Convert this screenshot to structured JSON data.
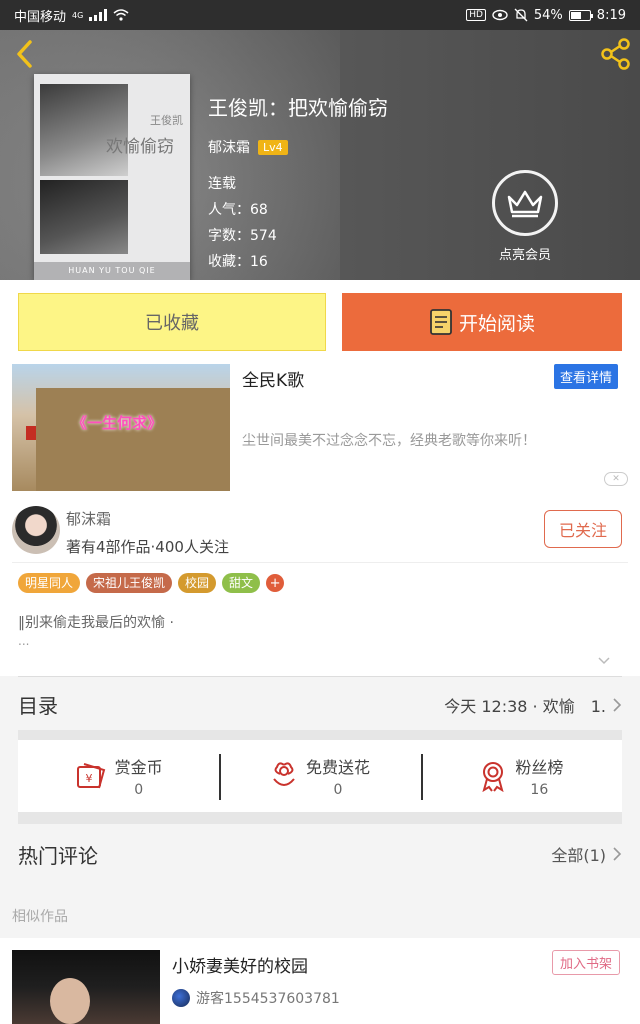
{
  "status_bar": {
    "carrier": "中国移动",
    "network": "4G",
    "battery": "54%",
    "battery_level": 0.54,
    "time": "8:19",
    "hd_label": "HD"
  },
  "book": {
    "title": "王俊凯：把欢愉偷窃",
    "author": "郁沫霜",
    "level": "Lv4",
    "status": "连载",
    "popularity": "人气：68",
    "word_count": "字数：574",
    "favorites": "收藏：16",
    "cover_title": "欢愉偷窃",
    "cover_name": "王俊凯",
    "cover_pinyin": "HUAN YU TOU QIE"
  },
  "vip": {
    "label": "点亮会员"
  },
  "actions": {
    "favorited_label": "已收藏",
    "read_label": "开始阅读"
  },
  "ad": {
    "image_text": "《一生何求》",
    "title": "全民K歌",
    "button": "查看详情",
    "description": "尘世间最美不过念念不忘，经典老歌等你来听！"
  },
  "author_card": {
    "name": "郁沫霜",
    "stats": "著有4部作品·400人关注",
    "follow_label": "已关注",
    "tags": [
      {
        "label": "明星同人",
        "color": "#f0a63a"
      },
      {
        "label": "宋祖儿王俊凯",
        "color": "#c56a4a"
      },
      {
        "label": "校园",
        "color": "#d49a2e"
      },
      {
        "label": "甜文",
        "color": "#8fbf4a"
      }
    ],
    "tag_add": "+",
    "intro": "‖别来偷走我最后的欢愉 ·",
    "intro_more": "..."
  },
  "toc": {
    "title": "目录",
    "latest": "今天 12:38 · 欢愉　1."
  },
  "stats": [
    {
      "label": "赏金币",
      "value": "0",
      "icon": "red-envelope-icon"
    },
    {
      "label": "免费送花",
      "value": "0",
      "icon": "flower-icon"
    },
    {
      "label": "粉丝榜",
      "value": "16",
      "icon": "medal-icon"
    }
  ],
  "comments": {
    "title": "热门评论",
    "all_label": "全部(1)"
  },
  "similar": {
    "section_label": "相似作品",
    "items": [
      {
        "title": "小娇妻美好的校园",
        "user": "游客1554537603781",
        "add_label": "加入书架"
      }
    ]
  },
  "colors": {
    "accent_orange": "#ec6b3c",
    "fav_yellow": "#fdf586",
    "vip_badge": "#f0b416",
    "ad_blue": "#2b74e4"
  }
}
